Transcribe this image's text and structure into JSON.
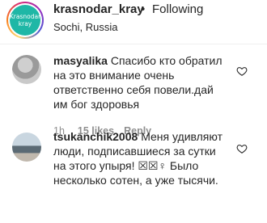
{
  "header": {
    "logo_text_line1": "Krasnodar",
    "logo_text_line2": "kray",
    "username": "krasnodar_kray",
    "separator": "•",
    "follow_status": "Following",
    "location": "Sochi, Russia"
  },
  "comments": [
    {
      "username": "masyalika",
      "text": "Спасибо кто обратил на это внимание очень ответственно себя повели.дай им бог здоровья",
      "time": "1h",
      "likes": "15 likes",
      "reply_label": "Reply"
    },
    {
      "username": "tsukanchik2008",
      "text": "Меня удивляют люди, подписавшиеся за сутки на этого упыря! ☒☒♀ Было несколько сотен, а уже тысячи."
    }
  ],
  "icons": {
    "heart": "heart-outline-icon"
  },
  "colors": {
    "text": "#262626",
    "secondary": "#8e8e8e",
    "logo_bg": "#1fb7a6"
  }
}
